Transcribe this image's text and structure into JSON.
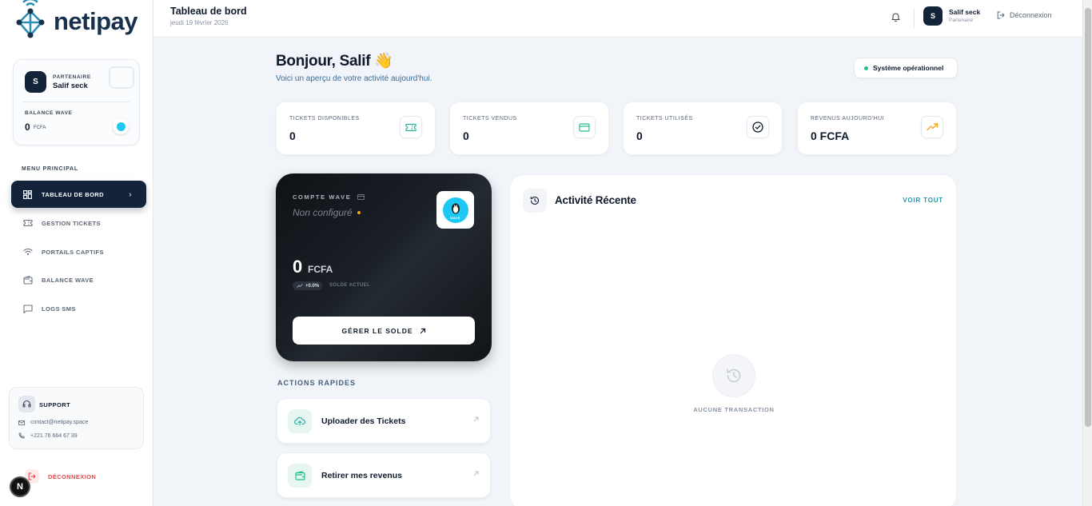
{
  "brand": {
    "name": "netipay"
  },
  "sidebar": {
    "partner": {
      "avatar": "S",
      "role": "PARTENAIRE",
      "name": "Salif seck"
    },
    "balance": {
      "label": "BALANCE WAVE",
      "value": "0",
      "unit": "FCFA"
    },
    "menu_label": "MENU PRINCIPAL",
    "items": [
      {
        "label": "TABLEAU DE BORD",
        "icon": "dashboard-icon",
        "active": true
      },
      {
        "label": "GESTION TICKETS",
        "icon": "ticket-icon",
        "active": false
      },
      {
        "label": "PORTAILS CAPTIFS",
        "icon": "wifi-icon",
        "active": false
      },
      {
        "label": "BALANCE WAVE",
        "icon": "wallet-icon",
        "active": false
      },
      {
        "label": "LOGS SMS",
        "icon": "message-icon",
        "active": false
      }
    ],
    "support": {
      "title": "SUPPORT",
      "email": "contact@netipay.space",
      "phone": "+221 76 664 67 39"
    },
    "logout_label": "DÉCONNEXION"
  },
  "header": {
    "title": "Tableau de bord",
    "date": "jeudi 19 février 2026",
    "user": {
      "avatar": "S",
      "name": "Salif seck",
      "role": "Partenaire"
    },
    "logout_label": "Déconnexion"
  },
  "main": {
    "greeting": "Bonjour, Salif 👋",
    "subtitle": "Voici un aperçu de votre activité aujourd'hui.",
    "status": "Système opérationnel",
    "stats": [
      {
        "label": "TICKETS DISPONIBLES",
        "value": "0",
        "icon": "ticket-icon",
        "color": "#2bb3a3"
      },
      {
        "label": "TICKETS VENDUS",
        "value": "0",
        "icon": "credit-card-icon",
        "color": "#22c08b"
      },
      {
        "label": "TICKETS UTILISÉS",
        "value": "0",
        "icon": "check-circle-icon",
        "color": "#0f1b2d"
      },
      {
        "label": "REVENUS AUJOURD'HUI",
        "value": "0 FCFA",
        "icon": "trending-up-icon",
        "color": "#f5a524"
      }
    ],
    "wave_card": {
      "title": "COMPTE WAVE",
      "status": "Non configuré",
      "logo_text": "WAVE",
      "amount": "0",
      "unit": "FCFA",
      "trend": "+0.0%",
      "trend_label": "SOLDE ACTUEL",
      "button": "GÉRER LE SOLDE"
    },
    "quick_actions": {
      "title": "ACTIONS RAPIDES",
      "items": [
        {
          "label": "Uploader des Tickets",
          "icon": "cloud-upload-icon"
        },
        {
          "label": "Retirer mes revenus",
          "icon": "wallet-icon"
        }
      ]
    },
    "activity": {
      "title": "Activité Récente",
      "link": "VOIR TOUT",
      "empty": "AUCUNE TRANSACTION"
    }
  },
  "colors": {
    "primary": "#13233a",
    "accent": "#1dc8f2",
    "success": "#22c08b",
    "danger": "#e5484d",
    "warning": "#f5a524"
  }
}
